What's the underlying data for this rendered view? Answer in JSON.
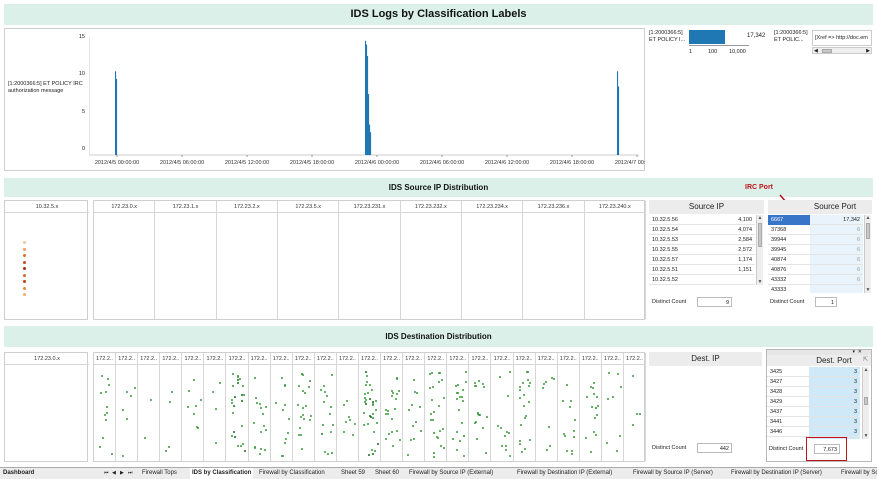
{
  "header": {
    "title": "IDS Logs by Classification Labels"
  },
  "timeline": {
    "row_label": "[1:2000366:5] ET POLICY IRC authorization message",
    "y_ticks": [
      "15",
      "10",
      "5",
      "0"
    ],
    "x_ticks": [
      "2012/4/5 00:00:00",
      "2012/4/5 06:00:00",
      "2012/4/5 12:00:00",
      "2012/4/5 18:00:00",
      "2012/4/6 00:00:00",
      "2012/4/6 06:00:00",
      "2012/4/6 12:00:00",
      "2012/4/6 18:00:00",
      "2012/4/7 00:00:00"
    ],
    "bar_color": "#1f77b4"
  },
  "summary": {
    "label": "[1:2000366:5] ET POLICY I...",
    "value": "17,342",
    "fraction": 0.6,
    "axis_ticks": [
      "1",
      "100",
      "10,000"
    ]
  },
  "detail": {
    "label": "[1:2000366:5] ET POLIC...",
    "xref": "[Xref => http://doc.em"
  },
  "source_section": {
    "title": "IDS Source IP Distribution",
    "subnet_left": "10.32.5.x",
    "subnets": [
      "172.23.0.x",
      "172.23.1.x",
      "172.23.2.x",
      "172.23.5.x",
      "172.23.231.x",
      "172.23.232.x",
      "172.23.234.x",
      "172.23.236.x",
      "172.23.240.x"
    ],
    "dot_colors": [
      "#f4c89a",
      "#f0a060",
      "#e07030",
      "#c84a20",
      "#a83010",
      "#d86a2c",
      "#c03a14",
      "#e88a40",
      "#f0b070"
    ]
  },
  "source_ip": {
    "title": "Source IP",
    "rows": [
      {
        "ip": "10.32.5.56",
        "count": "4,100"
      },
      {
        "ip": "10.32.5.54",
        "count": "4,074"
      },
      {
        "ip": "10.32.5.53",
        "count": "2,584"
      },
      {
        "ip": "10.32.5.55",
        "count": "2,572"
      },
      {
        "ip": "10.32.5.57",
        "count": "1,174"
      },
      {
        "ip": "10.32.5.51",
        "count": "1,151"
      },
      {
        "ip": "10.32.5.52",
        "count": ""
      }
    ],
    "distinct_label": "Distinct Count",
    "distinct_value": "9"
  },
  "annotation": {
    "label": "IRC Port",
    "color": "#c0141c"
  },
  "source_port": {
    "title": "Source Port",
    "rows": [
      {
        "port": "6667",
        "count": "17,342"
      },
      {
        "port": "37368",
        "count": "6"
      },
      {
        "port": "39944",
        "count": "6"
      },
      {
        "port": "39945",
        "count": "6"
      },
      {
        "port": "40874",
        "count": "6"
      },
      {
        "port": "40876",
        "count": "6"
      },
      {
        "port": "43332",
        "count": "6"
      },
      {
        "port": "43333",
        "count": ""
      }
    ],
    "distinct_label": "Distinct Count",
    "distinct_value": "1"
  },
  "dest_section": {
    "title": "IDS Destination Distribution",
    "subnet_left": "172.23.0.x",
    "subnet_label": "172.2..",
    "subnet_count": 25,
    "dot_color": "#3a9a3a",
    "dark_dot_color": "#1a6a1a"
  },
  "dest_ip": {
    "title": "Dest. IP",
    "distinct_label": "Distinct Count",
    "distinct_value": "442"
  },
  "dest_port": {
    "title": "Dest. Port",
    "rows": [
      {
        "port": "3425",
        "count": "3"
      },
      {
        "port": "3427",
        "count": "3"
      },
      {
        "port": "3428",
        "count": "3"
      },
      {
        "port": "3429",
        "count": "3"
      },
      {
        "port": "3437",
        "count": "3"
      },
      {
        "port": "3441",
        "count": "3"
      },
      {
        "port": "3446",
        "count": "3"
      },
      {
        "port": "",
        "count": ""
      }
    ],
    "distinct_label": "Distinct Count",
    "distinct_value": "7,673"
  },
  "tabs": {
    "dashboard": "Dashboard",
    "nav_glyphs": [
      "⏮",
      "◀",
      "▶",
      "⏭"
    ],
    "items": [
      "Firewall Tops",
      "IDS by Classification",
      "Firewall by Classification",
      "Sheet 59",
      "Sheet 60",
      "Firewall by Source IP (External)",
      "Firewall by Destination IP (External)",
      "Firewall by Source IP (Server)",
      "Firewall by Destination IP (Server)",
      "Firewall by Source IP"
    ],
    "active_index": 1
  }
}
